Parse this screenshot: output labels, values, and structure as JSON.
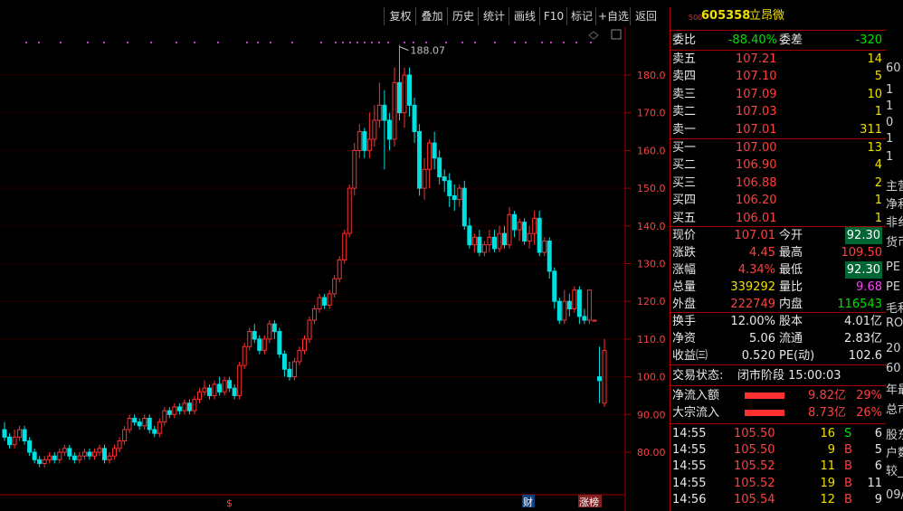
{
  "toolbar": {
    "buttons": [
      "复权",
      "叠加",
      "历史",
      "统计",
      "画线",
      "F10",
      "标记",
      "+自选",
      "返回"
    ]
  },
  "stock": {
    "exchange_tag": "500",
    "code": "605358",
    "name": "立昂微"
  },
  "weibi": {
    "label": "委比",
    "value": "-88.40%",
    "label2": "委差",
    "value2": "-320"
  },
  "sells": [
    {
      "label": "卖五",
      "price": "107.21",
      "vol": "14"
    },
    {
      "label": "卖四",
      "price": "107.10",
      "vol": "5"
    },
    {
      "label": "卖三",
      "price": "107.09",
      "vol": "10"
    },
    {
      "label": "卖二",
      "price": "107.03",
      "vol": "1"
    },
    {
      "label": "卖一",
      "price": "107.01",
      "vol": "311"
    }
  ],
  "buys": [
    {
      "label": "买一",
      "price": "107.00",
      "vol": "13"
    },
    {
      "label": "买二",
      "price": "106.90",
      "vol": "4"
    },
    {
      "label": "买三",
      "price": "106.88",
      "vol": "2"
    },
    {
      "label": "买四",
      "price": "106.20",
      "vol": "1"
    },
    {
      "label": "买五",
      "price": "106.01",
      "vol": "1"
    }
  ],
  "quote": {
    "xianjia": {
      "label": "现价",
      "value": "107.01"
    },
    "jinkai": {
      "label": "今开",
      "value": "92.30"
    },
    "zhangdie": {
      "label": "涨跌",
      "value": "4.45"
    },
    "zuigao": {
      "label": "最高",
      "value": "109.50"
    },
    "zhangfu": {
      "label": "涨幅",
      "value": "4.34%"
    },
    "zuidi": {
      "label": "最低",
      "value": "92.30"
    },
    "zongliang": {
      "label": "总量",
      "value": "339292"
    },
    "liangbi": {
      "label": "量比",
      "value": "9.68"
    },
    "waipan": {
      "label": "外盘",
      "value": "222749"
    },
    "neipan": {
      "label": "内盘",
      "value": "116543"
    }
  },
  "fund": {
    "huanshou": {
      "label": "换手",
      "value": "12.00%"
    },
    "guben": {
      "label": "股本",
      "value": "4.01亿"
    },
    "jingzi": {
      "label": "净资",
      "value": "5.06"
    },
    "liutong": {
      "label": "流通",
      "value": "2.83亿"
    },
    "shouyi": {
      "label": "收益㈢",
      "value": "0.520"
    },
    "pe": {
      "label": "PE(动)",
      "value": "102.6"
    }
  },
  "trade_status": {
    "label": "交易状态:",
    "value": "闭市阶段 15:00:03"
  },
  "flows": [
    {
      "label": "净流入额",
      "value": "9.82亿",
      "pct": "29%"
    },
    {
      "label": "大宗流入",
      "value": "8.73亿",
      "pct": "26%"
    }
  ],
  "ticks": [
    {
      "time": "14:55",
      "price": "105.50",
      "vol": "16",
      "dir": "S",
      "n": "6"
    },
    {
      "time": "14:55",
      "price": "105.50",
      "vol": "9",
      "dir": "B",
      "n": "5"
    },
    {
      "time": "14:55",
      "price": "105.52",
      "vol": "11",
      "dir": "B",
      "n": "6"
    },
    {
      "time": "14:55",
      "price": "105.52",
      "vol": "19",
      "dir": "B",
      "n": "11"
    },
    {
      "time": "14:56",
      "price": "105.54",
      "vol": "12",
      "dir": "B",
      "n": "9"
    }
  ],
  "chart_labels": {
    "high_marker": "188.07",
    "ylabels": [
      "180.0",
      "170.0",
      "160.0",
      "150.0",
      "140.0",
      "130.0",
      "120.0",
      "110.0",
      "100.0",
      "90.00",
      "80.00"
    ],
    "marker_s": "$",
    "marker_cai": "财",
    "marker_zhangting": "涨榜"
  },
  "right_strip": [
    "60",
    "1",
    "1",
    "0",
    "1",
    "1",
    "主营",
    "净利",
    "非纟",
    "货币",
    "PE",
    "PE",
    "毛利",
    "RO",
    "20",
    "60",
    "年最",
    "总市",
    "股东",
    "户数",
    "较_",
    "09/"
  ],
  "colors": {
    "up": "#ff3030",
    "down": "#00e0e0",
    "accent": "#a00000"
  }
}
